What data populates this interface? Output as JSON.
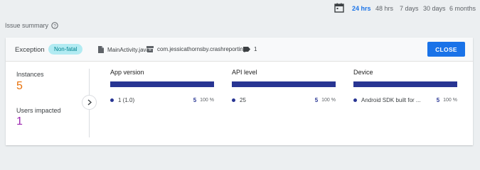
{
  "time_range": {
    "icon": "calendar-icon",
    "options": [
      "24 hrs",
      "48 hrs",
      "7 days",
      "30 days",
      "6 months"
    ],
    "selected": "24 hrs"
  },
  "issue_summary": {
    "title": "Issue summary",
    "help_icon": "help-circle-icon"
  },
  "header": {
    "title": "Exception",
    "badge": "Non-fatal",
    "file": "MainActivity.java",
    "package": "com.jessicathornsby.crashreporting",
    "label_count": "1",
    "close_label": "CLOSE"
  },
  "stats": {
    "instances_label": "Instances",
    "instances_value": "5",
    "users_label": "Users impacted",
    "users_value": "1"
  },
  "columns": [
    {
      "title": "App version",
      "item_label": "1 (1.0)",
      "count": "5",
      "percent": "100 %"
    },
    {
      "title": "API level",
      "item_label": "25",
      "count": "5",
      "percent": "100 %"
    },
    {
      "title": "Device",
      "item_label": "Android SDK built for ...",
      "count": "5",
      "percent": "100 %"
    }
  ],
  "colors": {
    "accent": "#1a73e8",
    "bar": "#283593",
    "instances": "#e8710a",
    "users": "#9c27b0",
    "badge_bg": "#b2ebf2",
    "badge_text": "#00838f"
  }
}
